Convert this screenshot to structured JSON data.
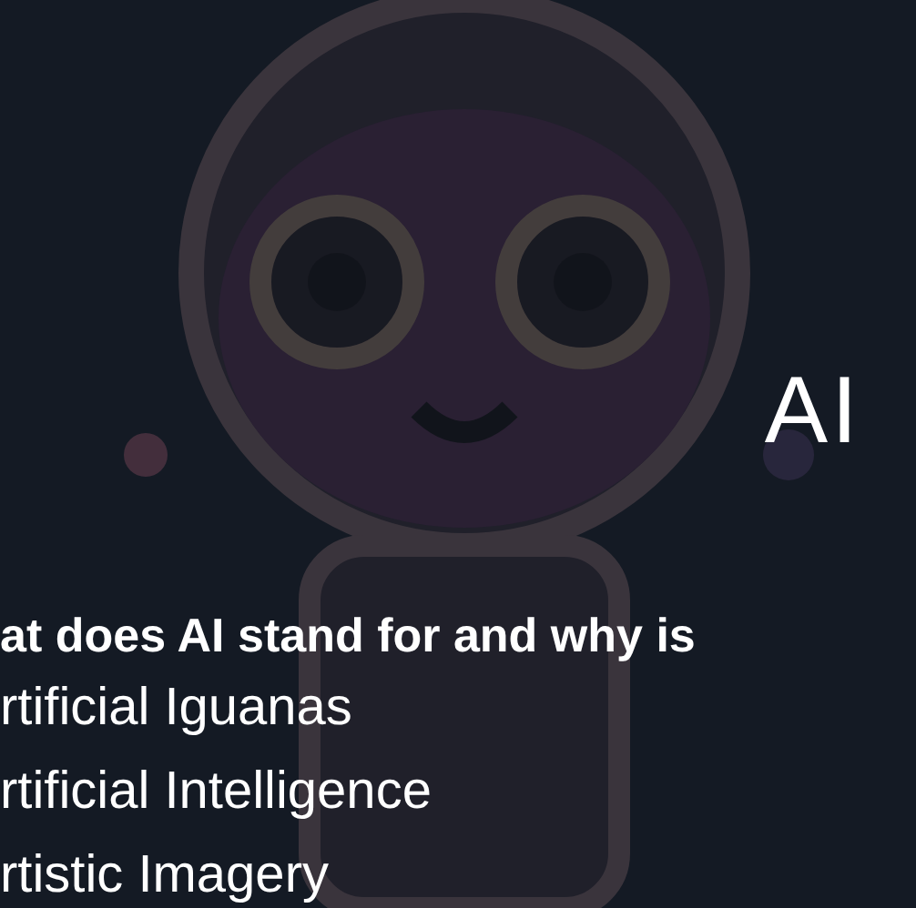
{
  "hero": {
    "title": "AI"
  },
  "quiz": {
    "question": "at does AI stand for and why is",
    "options": [
      {
        "text": "rtificial Iguanas"
      },
      {
        "text": "rtificial Intelligence"
      },
      {
        "text": "rtistic Imagery"
      }
    ]
  }
}
